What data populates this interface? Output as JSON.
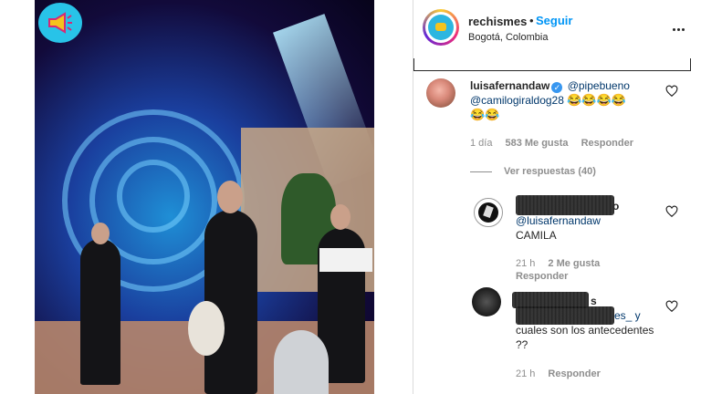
{
  "post": {
    "username": "rechismes",
    "follow_label": "Seguir",
    "separator": "•",
    "location": "Bogotá, Colombia"
  },
  "comments": [
    {
      "username": "luisafernandaw",
      "verified": true,
      "mention1": "@pipebueno",
      "mention2": "@camilogiraldog28",
      "emojis_line1": "😂😂😂😂",
      "emojis_line2": "😂😂",
      "time": "1 día",
      "likes": "583 Me gusta",
      "reply_label": "Responder",
      "view_replies": "Ver respuestas (40)"
    },
    {
      "username_partial": "o",
      "mention": "@luisafernandaw",
      "text": "CAMILA",
      "time": "21 h",
      "likes": "2 Me gusta",
      "reply_label": "Responder"
    },
    {
      "username_partial": "s",
      "mention_partial": "es_ y",
      "text": "cuales son los antecedentes ??",
      "time": "21 h",
      "reply_label": "Responder"
    }
  ],
  "icons": {
    "more": "more-options-icon",
    "heart": "heart-icon",
    "megaphone": "megaphone-icon"
  },
  "colors": {
    "link_blue": "#0095f6",
    "mention_blue": "#00376b",
    "muted": "#8e8e8e"
  }
}
